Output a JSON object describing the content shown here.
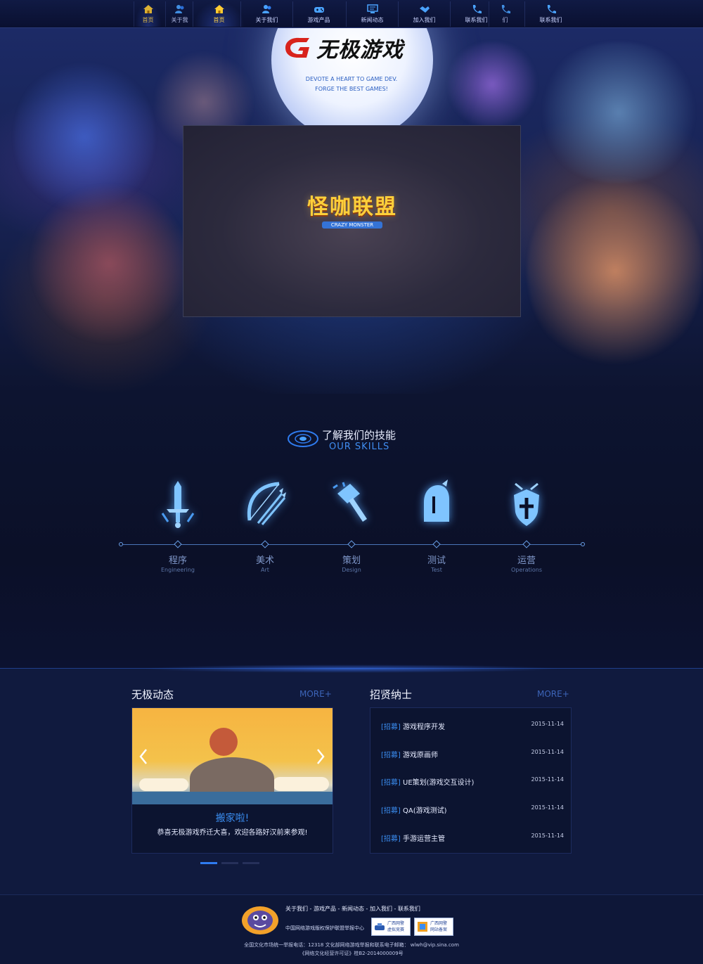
{
  "nav": {
    "items": [
      {
        "label": "首页",
        "icon": "home-icon",
        "active": true
      },
      {
        "label": "关于我",
        "icon": "users-icon",
        "active": false
      },
      {
        "label": "首页",
        "icon": "home-icon",
        "active": true
      },
      {
        "label": "关于我们",
        "icon": "users-icon",
        "active": false
      },
      {
        "label": "游戏产品",
        "icon": "gamepad-icon",
        "active": false
      },
      {
        "label": "新闻动态",
        "icon": "monitor-icon",
        "active": false
      },
      {
        "label": "加入我们",
        "icon": "handshake-icon",
        "active": false
      },
      {
        "label": "联系我们",
        "icon": "phone-icon",
        "active": false
      },
      {
        "label": "们",
        "icon": "phone-icon",
        "active": false
      },
      {
        "label": "联系我们",
        "icon": "phone-icon",
        "active": false
      }
    ]
  },
  "hero": {
    "logo_text": "无极游戏",
    "slogan_line1": "DEVOTE A HEART TO GAME DEV.",
    "slogan_line2": "FORGE THE BEST GAMES!",
    "video_logo_cn": "怪咖联盟",
    "video_logo_en": "CRAZY MONSTER"
  },
  "skills": {
    "title_cn": "了解我们的技能",
    "title_en": "OUR  SKILLS",
    "items": [
      {
        "cn": "程序",
        "en": "Engineering",
        "icon": "sword-icon"
      },
      {
        "cn": "美术",
        "en": "Art",
        "icon": "bow-icon"
      },
      {
        "cn": "策划",
        "en": "Design",
        "icon": "hammer-icon"
      },
      {
        "cn": "测试",
        "en": "Test",
        "icon": "helmet-icon"
      },
      {
        "cn": "运营",
        "en": "Operations",
        "icon": "shield-icon"
      }
    ]
  },
  "news": {
    "title": "无极动态",
    "more": "MORE+",
    "headline": "搬家啦!",
    "desc": "恭喜无极游戏乔迁大喜，欢迎各路好汉前来参观!",
    "slides": 3,
    "active_slide": 1
  },
  "jobs": {
    "title": "招贤纳士",
    "more": "MORE+",
    "items": [
      {
        "tag": "[招募]",
        "name": "游戏程序开发",
        "date": "2015-11-14"
      },
      {
        "tag": "[招募]",
        "name": "游戏原画师",
        "date": "2015-11-14"
      },
      {
        "tag": "[招募]",
        "name": "UE策划(游戏交互设计)",
        "date": "2015-11-14"
      },
      {
        "tag": "[招募]",
        "name": "QA(游戏测试)",
        "date": "2015-11-14"
      },
      {
        "tag": "[招募]",
        "name": "手游运营主管",
        "date": "2015-11-14"
      }
    ]
  },
  "footer": {
    "links": [
      "关于我们",
      "游戏产品",
      "新闻动态",
      "加入我们",
      "联系我们"
    ],
    "separator": " - ",
    "org": "中国网络游戏版权保护联盟举报中心",
    "badge1_line1": "广西网警",
    "badge1_line2": "虚拟竞赛",
    "badge2_line1": "广西网警",
    "badge2_line2": "网站备案",
    "line1": "全国文化市场统一举报电话：12318    文化部网络游戏举报和联系电子邮箱：  wlwh@vip.sina.com",
    "line2": "《网络文化经营许可证》桂B2-2014000009号"
  },
  "colors": {
    "accent": "#3a8df0",
    "nav_active": "#ffd34a",
    "bg": "#0c1128",
    "panel": "#0c1430"
  }
}
